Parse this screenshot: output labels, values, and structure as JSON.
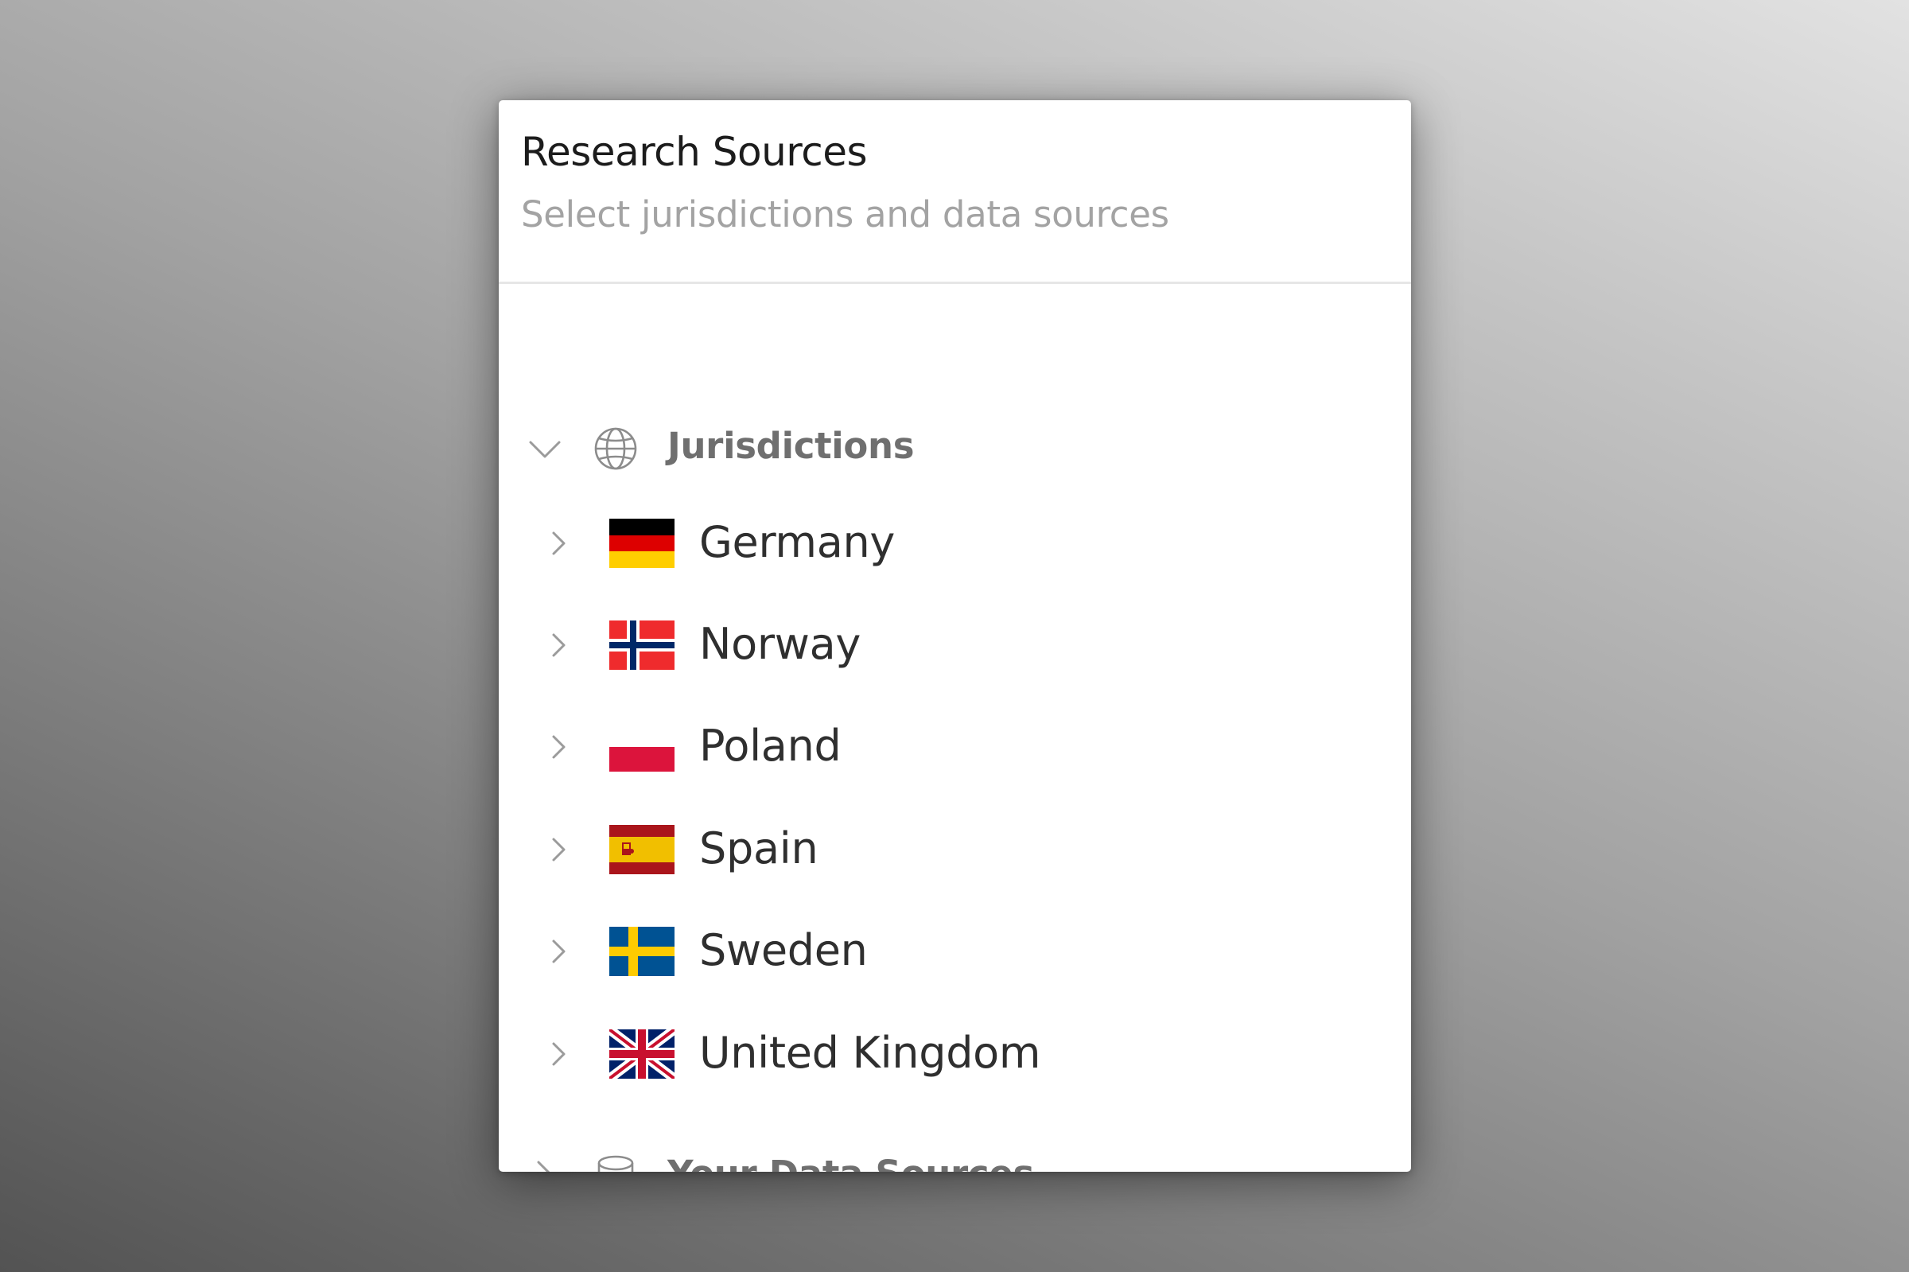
{
  "panel": {
    "title": "Research Sources",
    "subtitle": "Select jurisdictions and data sources"
  },
  "sections": {
    "jurisdictions": {
      "label": "Jurisdictions",
      "icon": "globe-icon",
      "expanded": true,
      "countries": [
        {
          "name": "Germany",
          "flag": "flag-germany-icon"
        },
        {
          "name": "Norway",
          "flag": "flag-norway-icon"
        },
        {
          "name": "Poland",
          "flag": "flag-poland-icon"
        },
        {
          "name": "Spain",
          "flag": "flag-spain-icon"
        },
        {
          "name": "Sweden",
          "flag": "flag-sweden-icon"
        },
        {
          "name": "United Kingdom",
          "flag": "flag-united-kingdom-icon"
        }
      ]
    },
    "data_sources": {
      "label": "Your Data Sources",
      "icon": "database-icon",
      "expanded": false
    }
  },
  "colors": {
    "title": "#1c1c1c",
    "subtitle": "#a3a3a3",
    "section_label": "#6f6f6f",
    "country_text": "#2f2f2f",
    "chevron": "#9b9b9b",
    "divider": "#e6e6e6"
  }
}
